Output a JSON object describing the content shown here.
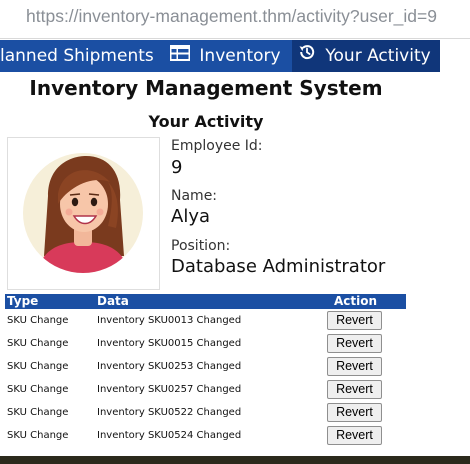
{
  "browser": {
    "url": "https://inventory-management.thm/activity?user_id=9"
  },
  "nav": {
    "items": [
      {
        "label": "lanned Shipments",
        "icon": null
      },
      {
        "label": "Inventory",
        "icon": "table-icon"
      },
      {
        "label": "Your Activity",
        "icon": "history-icon",
        "active": true
      }
    ]
  },
  "header": {
    "app_title": "Inventory Management System",
    "page_title": "Your Activity"
  },
  "profile": {
    "employee_id_label": "Employee Id:",
    "employee_id": "9",
    "name_label": "Name:",
    "name": "Alya",
    "position_label": "Position:",
    "position": "Database Administrator"
  },
  "activity_table": {
    "columns": [
      "Type",
      "Data",
      "Action"
    ],
    "rows": [
      {
        "type": "SKU Change",
        "data": "Inventory SKU0013 Changed",
        "action": "Revert"
      },
      {
        "type": "SKU Change",
        "data": "Inventory SKU0015 Changed",
        "action": "Revert"
      },
      {
        "type": "SKU Change",
        "data": "Inventory SKU0253 Changed",
        "action": "Revert"
      },
      {
        "type": "SKU Change",
        "data": "Inventory SKU0257 Changed",
        "action": "Revert"
      },
      {
        "type": "SKU Change",
        "data": "Inventory SKU0522 Changed",
        "action": "Revert"
      },
      {
        "type": "SKU Change",
        "data": "Inventory SKU0524 Changed",
        "action": "Revert"
      }
    ]
  },
  "colors": {
    "nav_bg": "#1b4fa3",
    "nav_active_bg": "#10367a",
    "table_header_bg": "#1b4fa3"
  }
}
